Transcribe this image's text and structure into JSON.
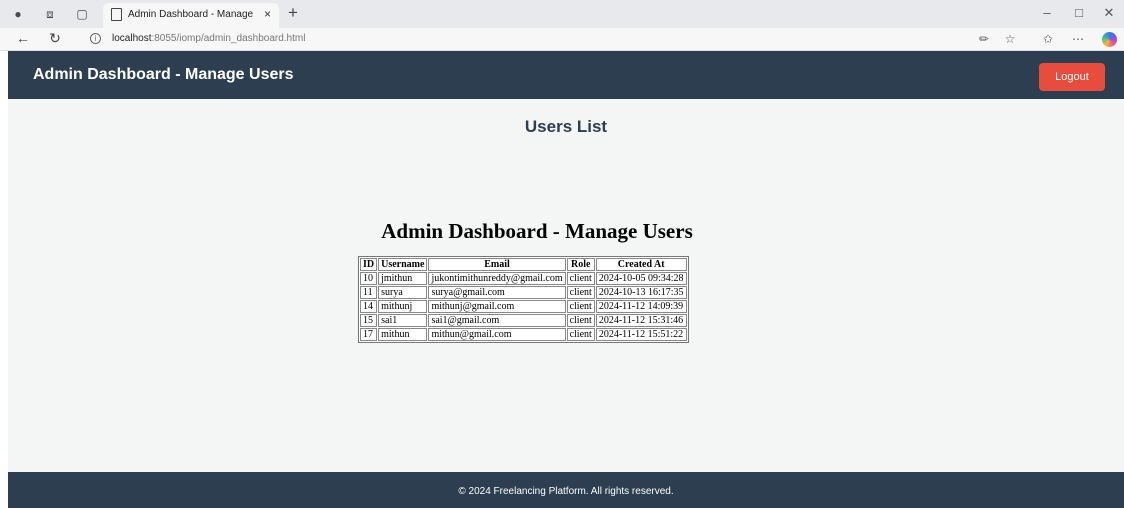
{
  "browser": {
    "tab_title": "Admin Dashboard - Manage User",
    "tab_close": "×",
    "new_tab": "+",
    "url_host": "localhost",
    "url_path": ":8055/iomp/admin_dashboard.html",
    "icons": [
      "profile-icon",
      "workspaces-icon",
      "tab-actions-icon",
      "back-icon",
      "refresh-icon",
      "info-icon",
      "read-aloud-icon",
      "favorite-icon",
      "favorites-bar-icon",
      "more-icon",
      "copilot-icon"
    ]
  },
  "header": {
    "title": "Admin Dashboard - Manage Users",
    "logout_label": "Logout",
    "background": "#2c3e50",
    "logout_color": "#e74c3c"
  },
  "main": {
    "heading": "Users List",
    "inner_heading": "Admin Dashboard - Manage Users",
    "table": {
      "columns": [
        "ID",
        "Username",
        "Email",
        "Role",
        "Created At"
      ],
      "rows": [
        [
          "10",
          "jmithun",
          "jukontimithunreddy@gmail.com",
          "client",
          "2024-10-05 09:34:28"
        ],
        [
          "11",
          "surya",
          "surya@gmail.com",
          "client",
          "2024-10-13 16:17:35"
        ],
        [
          "14",
          "mithunj",
          "mithunj@gmail.com",
          "client",
          "2024-11-12 14:09:39"
        ],
        [
          "15",
          "sai1",
          "sai1@gmail.com",
          "client",
          "2024-11-12 15:31:46"
        ],
        [
          "17",
          "mithun",
          "mithun@gmail.com",
          "client",
          "2024-11-12 15:51:22"
        ]
      ]
    }
  },
  "footer": {
    "text": "© 2024 Freelancing Platform. All rights reserved."
  }
}
